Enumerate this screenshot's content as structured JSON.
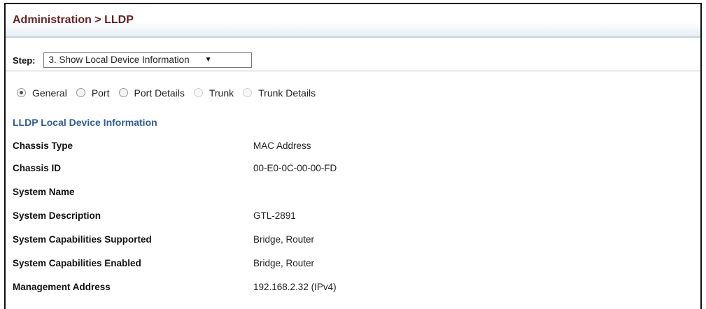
{
  "header": {
    "breadcrumb": "Administration > LLDP"
  },
  "step": {
    "label": "Step:",
    "selected": "3. Show Local Device Information",
    "arrow": "▼"
  },
  "view_options": [
    {
      "label": "General",
      "checked": true,
      "enabled": true
    },
    {
      "label": "Port",
      "checked": false,
      "enabled": true
    },
    {
      "label": "Port Details",
      "checked": false,
      "enabled": true
    },
    {
      "label": "Trunk",
      "checked": false,
      "enabled": false
    },
    {
      "label": "Trunk Details",
      "checked": false,
      "enabled": false
    }
  ],
  "section": {
    "title": "LLDP Local Device Information"
  },
  "info": [
    {
      "label": "Chassis Type",
      "value": "MAC Address"
    },
    {
      "label": "Chassis ID",
      "value": "00-E0-0C-00-00-FD"
    },
    {
      "label": "System Name",
      "value": ""
    },
    {
      "label": "System Description",
      "value": "GTL-2891"
    },
    {
      "label": "System Capabilities Supported",
      "value": "Bridge, Router"
    },
    {
      "label": "System Capabilities Enabled",
      "value": "Bridge, Router"
    },
    {
      "label": "Management Address",
      "value": "192.168.2.32 (IPv4)"
    }
  ]
}
